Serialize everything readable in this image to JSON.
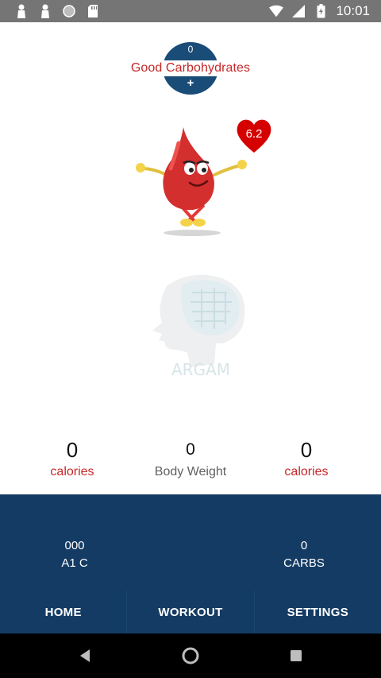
{
  "status_bar": {
    "time": "10:01",
    "icons_left": [
      "person-icon",
      "person-icon",
      "circle-icon",
      "sd-card-icon"
    ],
    "icons_right": [
      "wifi-icon",
      "signal-icon",
      "battery-icon"
    ]
  },
  "carbs_header": {
    "count": "0",
    "title": "Good Carbohydrates",
    "add_label": "+"
  },
  "glucose_badge": {
    "value": "6.2"
  },
  "stats": {
    "left": {
      "value": "0",
      "label": "calories"
    },
    "middle": {
      "value": "0",
      "label": "Body Weight"
    },
    "right": {
      "value": "0",
      "label": "calories"
    }
  },
  "metrics": {
    "a1c": {
      "value": "000",
      "label": "A1 C"
    },
    "carbs": {
      "value": "0",
      "label": "CARBS"
    }
  },
  "bottom_nav": {
    "home": "HOME",
    "workout": "WORKOUT",
    "settings": "SETTINGS"
  },
  "colors": {
    "panel": "#143b63",
    "accent_red": "#c62828",
    "status_bar": "#757575"
  }
}
